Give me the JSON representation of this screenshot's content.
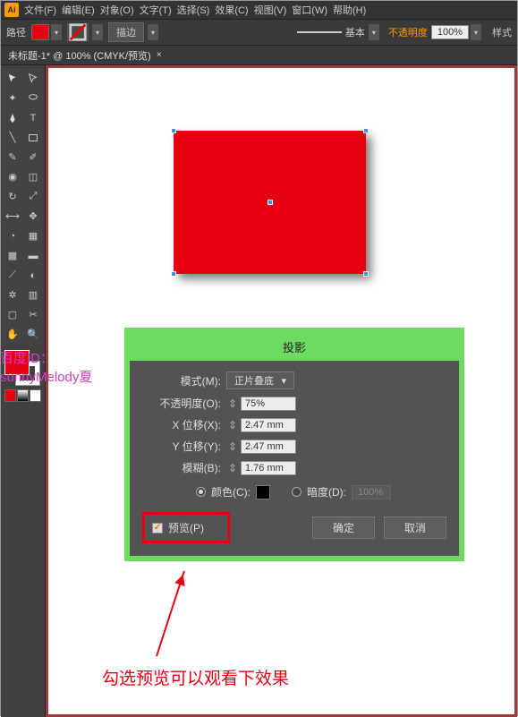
{
  "menubar": {
    "items": [
      "文件(F)",
      "编辑(E)",
      "对象(O)",
      "文字(T)",
      "选择(S)",
      "效果(C)",
      "视图(V)",
      "窗口(W)",
      "帮助(H)"
    ]
  },
  "controlbar": {
    "path_label": "路径",
    "stroke_btn": "描边",
    "basic_label": "基本",
    "opacity_label": "不透明度",
    "opacity_value": "100%",
    "style_label": "样式"
  },
  "tabbar": {
    "title": "未标题-1* @ 100% (CMYK/预览)"
  },
  "dialog": {
    "title": "投影",
    "mode_label": "模式(M):",
    "mode_value": "正片叠底",
    "opacity_label": "不透明度(O):",
    "opacity_value": "75%",
    "xoffset_label": "X 位移(X):",
    "xoffset_value": "2.47 mm",
    "yoffset_label": "Y 位移(Y):",
    "yoffset_value": "2.47 mm",
    "blur_label": "模糊(B):",
    "blur_value": "1.76 mm",
    "color_label": "颜色(C):",
    "darkness_label": "暗度(D):",
    "darkness_value": "100%",
    "preview_label": "预览(P)",
    "ok_btn": "确定",
    "cancel_btn": "取消"
  },
  "watermark": {
    "line1": "百度ID：",
    "line2": "sunnyMelody夏"
  },
  "annotation": "勾选预览可以观看下效果"
}
